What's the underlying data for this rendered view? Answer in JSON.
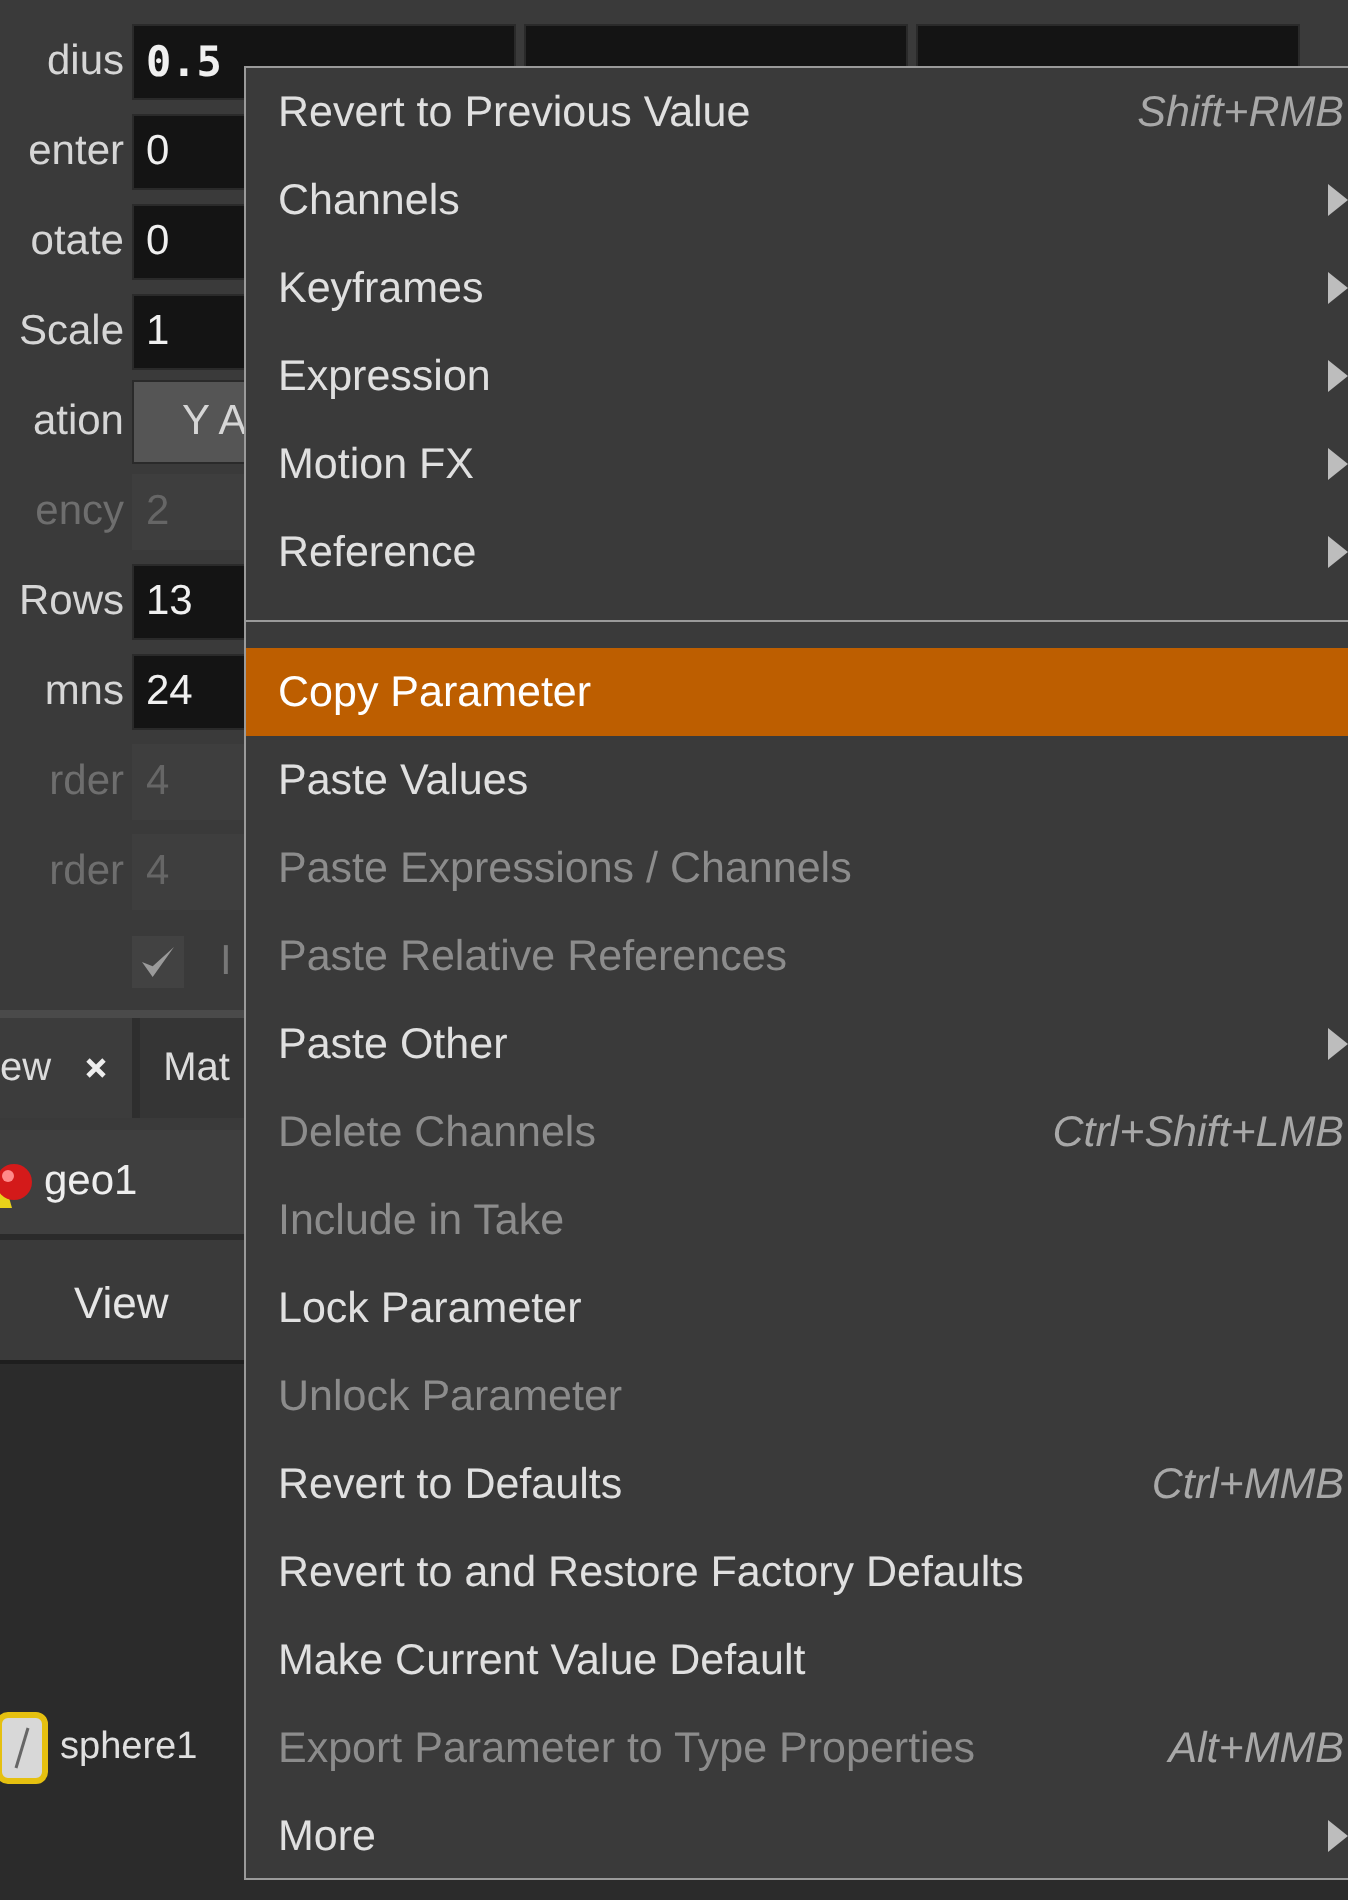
{
  "parameters": [
    {
      "label": "dius",
      "kind": "vector",
      "values": [
        "0.5"
      ],
      "disabled": false
    },
    {
      "label": "enter",
      "values": [
        "0"
      ],
      "disabled": false
    },
    {
      "label": "otate",
      "values": [
        "0"
      ],
      "disabled": false
    },
    {
      "label": "Scale",
      "values": [
        "1"
      ],
      "disabled": false
    },
    {
      "label": "ation",
      "button": "Y A",
      "disabled": false
    },
    {
      "label": "ency",
      "values": [
        "2"
      ],
      "disabled": true
    },
    {
      "label": "Rows",
      "values": [
        "13"
      ],
      "disabled": false
    },
    {
      "label": "mns",
      "values": [
        "24"
      ],
      "disabled": false
    },
    {
      "label": "rder",
      "values": [
        "4"
      ],
      "disabled": true
    },
    {
      "label": "rder",
      "values": [
        "4"
      ],
      "disabled": true
    }
  ],
  "checkbox": {
    "label": "I",
    "checked": true,
    "disabled": true
  },
  "tabs": [
    {
      "label": "ew",
      "selected": true
    },
    {
      "label": "Mat",
      "selected": false
    }
  ],
  "path": {
    "label": "geo1"
  },
  "menubar": [
    "View"
  ],
  "node": {
    "label": "sphere1",
    "selected": true
  },
  "context_menu": {
    "items": [
      {
        "kind": "item",
        "label": "Revert to Previous Value",
        "shortcut": "Shift+RMB",
        "submenu": false,
        "disabled": false,
        "selected": false
      },
      {
        "kind": "item",
        "label": "Channels",
        "submenu": true,
        "disabled": false,
        "selected": false
      },
      {
        "kind": "item",
        "label": "Keyframes",
        "submenu": true,
        "disabled": false,
        "selected": false
      },
      {
        "kind": "item",
        "label": "Expression",
        "submenu": true,
        "disabled": false,
        "selected": false
      },
      {
        "kind": "item",
        "label": "Motion FX",
        "submenu": true,
        "disabled": false,
        "selected": false
      },
      {
        "kind": "item",
        "label": "Reference",
        "submenu": true,
        "disabled": false,
        "selected": false
      },
      {
        "kind": "separator"
      },
      {
        "kind": "item",
        "label": "Copy Parameter",
        "submenu": false,
        "disabled": false,
        "selected": true
      },
      {
        "kind": "item",
        "label": "Paste Values",
        "submenu": false,
        "disabled": false,
        "selected": false
      },
      {
        "kind": "item",
        "label": "Paste Expressions / Channels",
        "submenu": false,
        "disabled": true,
        "selected": false
      },
      {
        "kind": "item",
        "label": "Paste Relative References",
        "submenu": false,
        "disabled": true,
        "selected": false
      },
      {
        "kind": "item",
        "label": "Paste Other",
        "submenu": true,
        "disabled": false,
        "selected": false
      },
      {
        "kind": "item",
        "label": "Delete Channels",
        "shortcut": "Ctrl+Shift+LMB",
        "submenu": false,
        "disabled": true,
        "selected": false
      },
      {
        "kind": "item",
        "label": "Include in Take",
        "submenu": false,
        "disabled": true,
        "selected": false
      },
      {
        "kind": "item",
        "label": "Lock Parameter",
        "submenu": false,
        "disabled": false,
        "selected": false
      },
      {
        "kind": "item",
        "label": "Unlock Parameter",
        "submenu": false,
        "disabled": true,
        "selected": false
      },
      {
        "kind": "item",
        "label": "Revert to Defaults",
        "shortcut": "Ctrl+MMB",
        "submenu": false,
        "disabled": false,
        "selected": false
      },
      {
        "kind": "item",
        "label": "Revert to and Restore Factory Defaults",
        "submenu": false,
        "disabled": false,
        "selected": false
      },
      {
        "kind": "item",
        "label": "Make Current Value Default",
        "submenu": false,
        "disabled": false,
        "selected": false
      },
      {
        "kind": "item",
        "label": "Export Parameter to Type Properties",
        "shortcut": "Alt+MMB",
        "submenu": false,
        "disabled": true,
        "selected": false
      },
      {
        "kind": "item",
        "label": "More",
        "submenu": true,
        "disabled": false,
        "selected": false
      }
    ]
  }
}
